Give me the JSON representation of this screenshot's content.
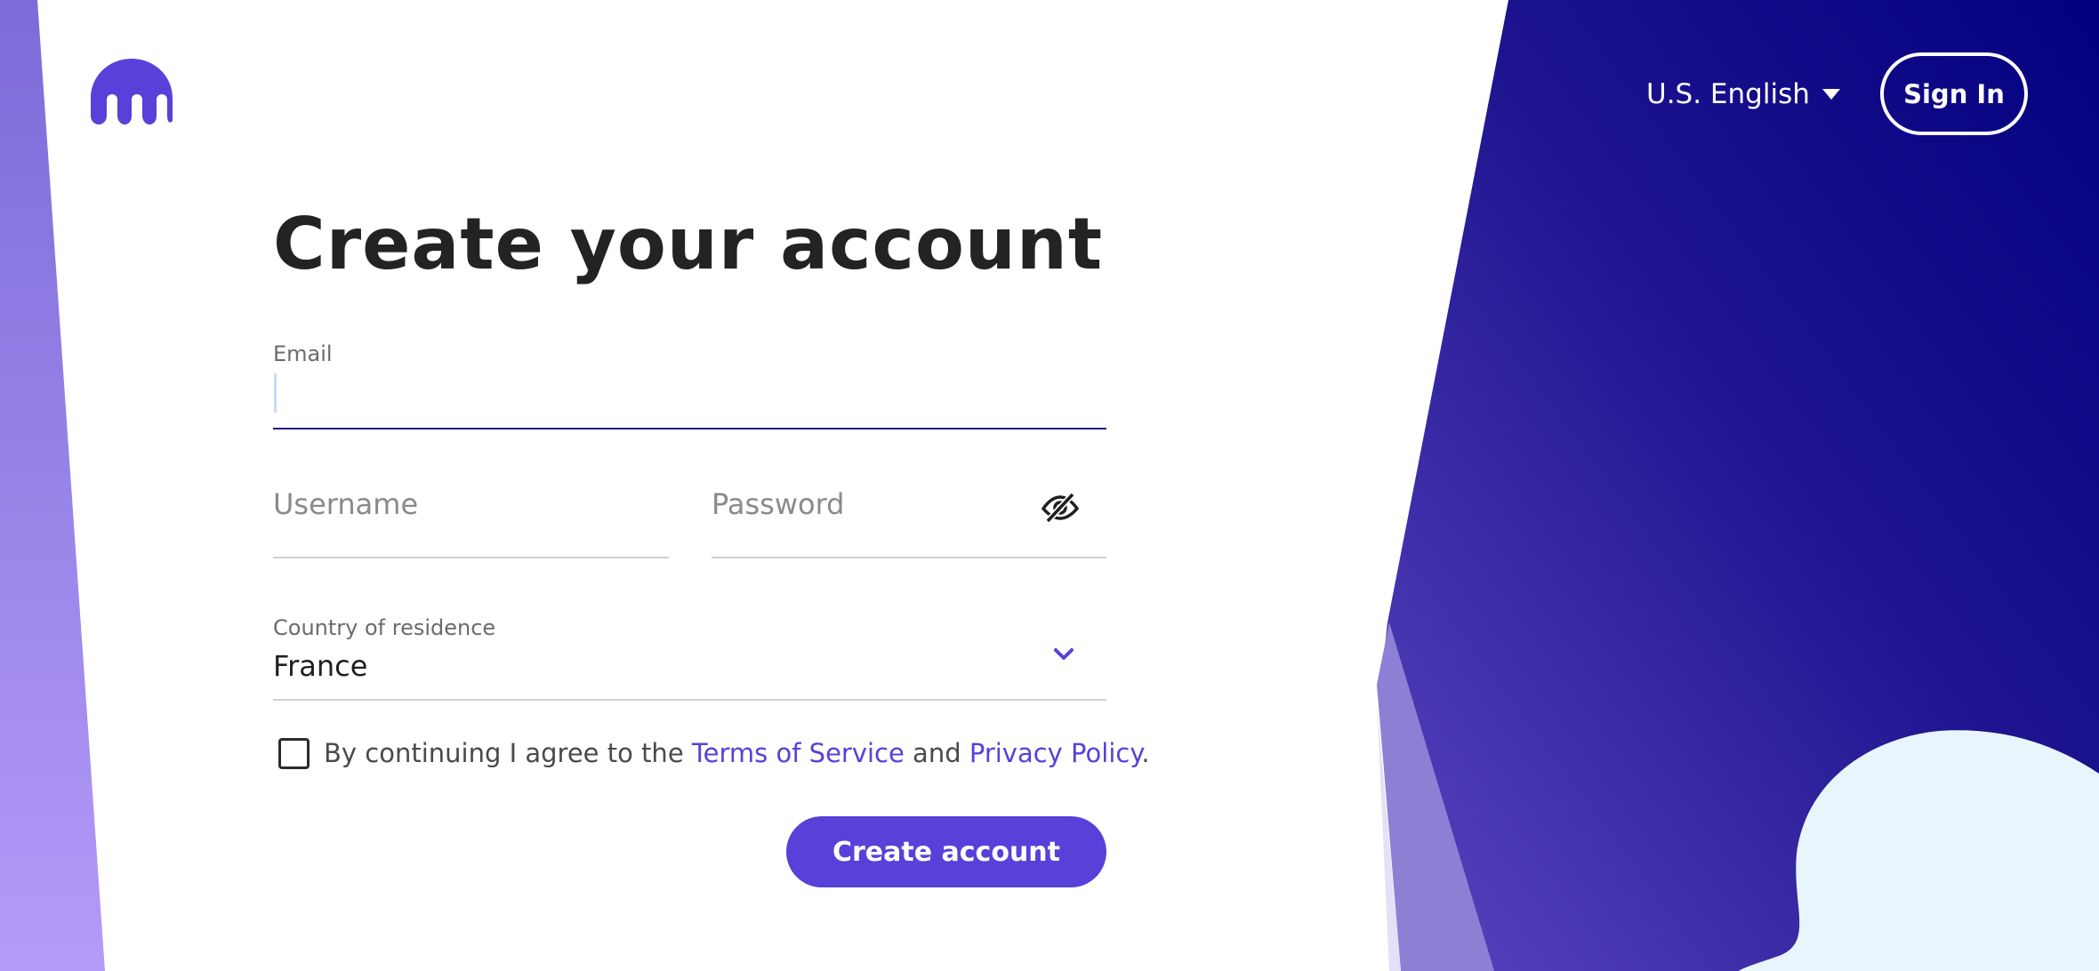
{
  "header": {
    "logo_icon": "kraken-logo-icon",
    "language": "U.S. English",
    "language_icon": "caret-down-icon",
    "sign_in": "Sign In"
  },
  "form": {
    "title": "Create your account",
    "email": {
      "label": "Email",
      "value": ""
    },
    "username": {
      "placeholder": "Username",
      "value": ""
    },
    "password": {
      "placeholder": "Password",
      "value": "",
      "toggle_icon": "eye-slash-icon"
    },
    "country": {
      "label": "Country of residence",
      "value": "France",
      "icon": "chevron-down-icon"
    },
    "agreement": {
      "checked": false,
      "prefix": "By continuing I agree to the ",
      "terms": "Terms of Service",
      "middle": " and ",
      "privacy": "Privacy Policy",
      "suffix": "."
    },
    "submit": "Create account"
  },
  "colors": {
    "brand": "#5741d9",
    "navy": "#040082",
    "text": "#232323",
    "light_blob": "#e8f5fd"
  }
}
